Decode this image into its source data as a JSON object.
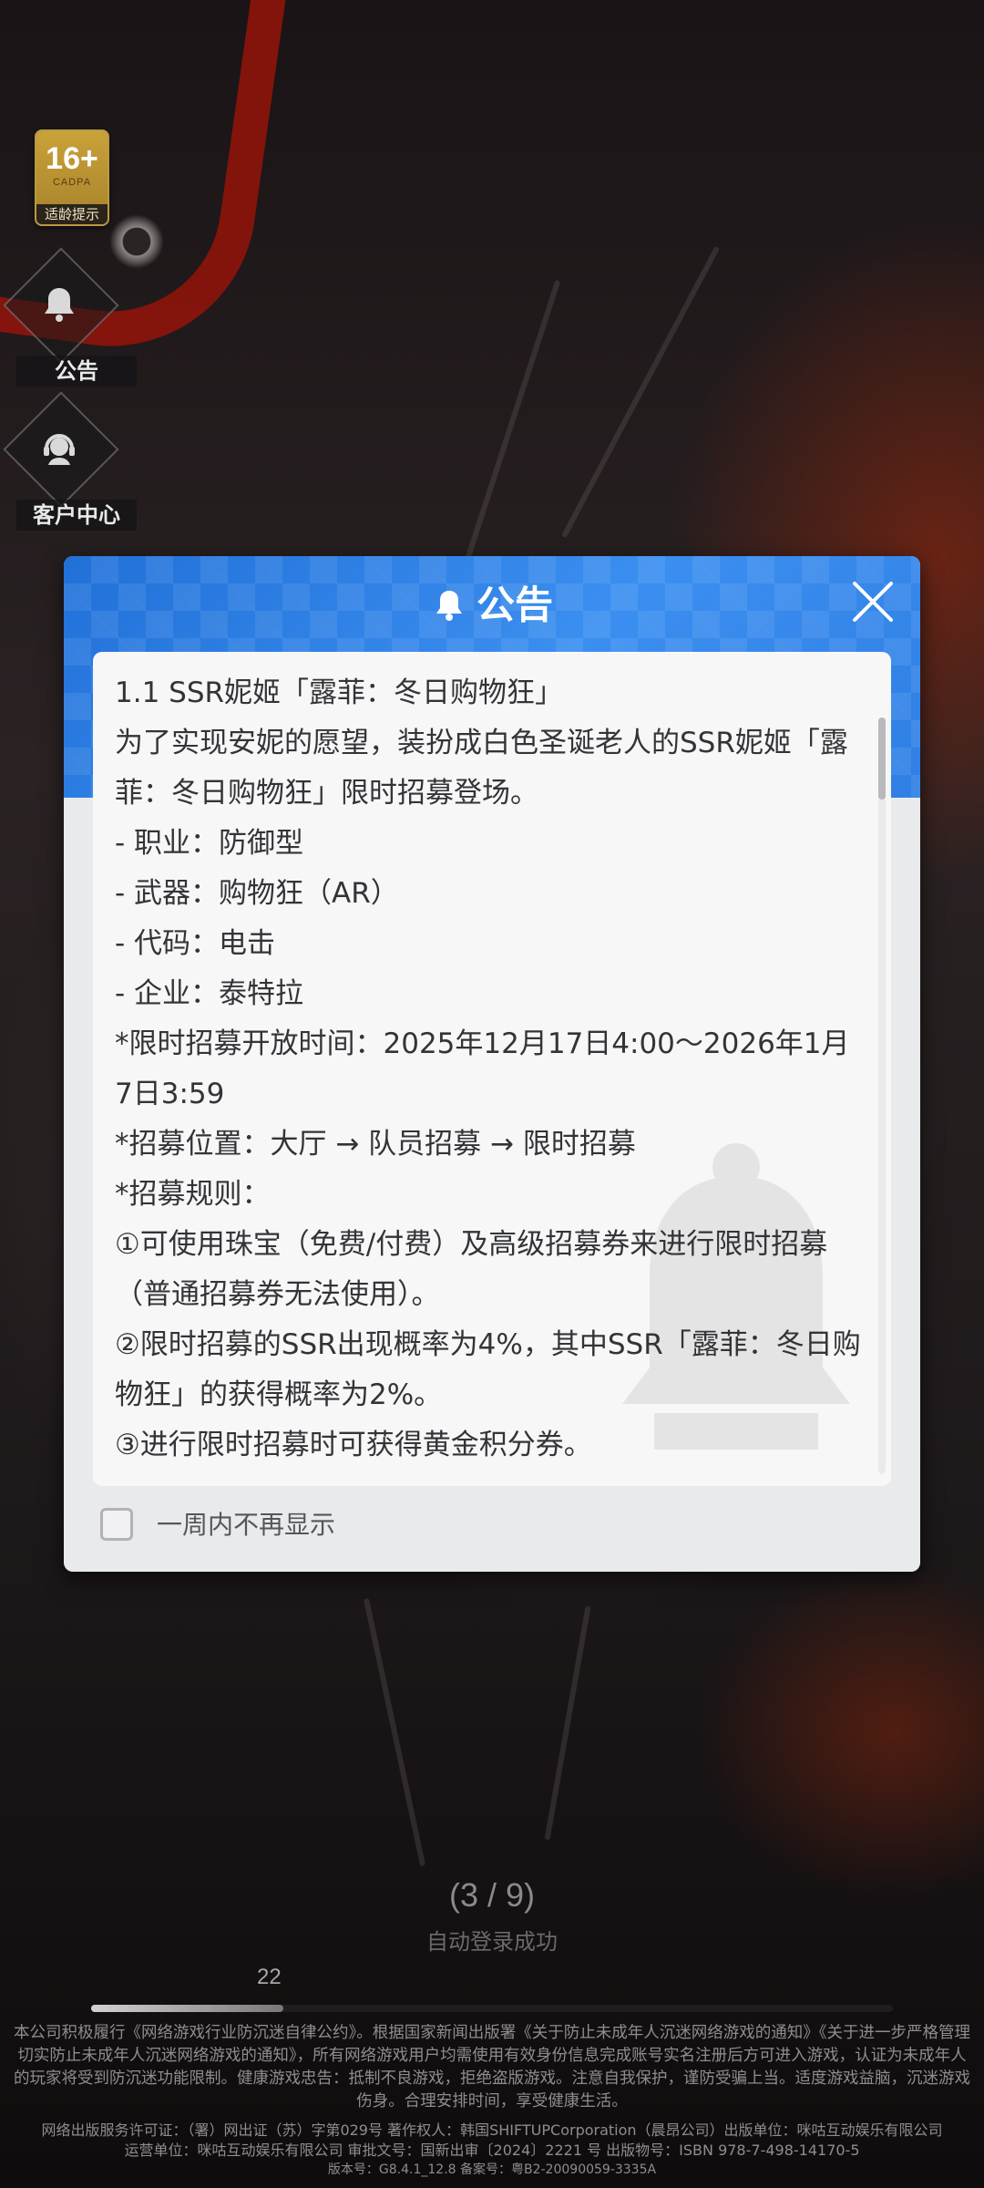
{
  "hud": {
    "age_rating": "16+",
    "age_org": "CADPA",
    "age_tip": "适龄提示",
    "notice_label": "公告",
    "support_label": "客户中心"
  },
  "dialog": {
    "title": "公告",
    "content": [
      "1.1 SSR妮姬「露菲：冬日购物狂」",
      "为了实现安妮的愿望，装扮成白色圣诞老人的SSR妮姬「露菲：冬日购物狂」限时招募登场。",
      " - 职业：防御型",
      " - 武器：购物狂（AR）",
      " - 代码：电击",
      " - 企业：泰特拉",
      "*限时招募开放时间：2025年12月17日4:00～2026年1月7日3:59",
      "*招募位置：大厅 → 队员招募 → 限时招募",
      "*招募规则：",
      "①可使用珠宝（免费/付费）及高级招募券来进行限时招募（普通招募券无法使用）。",
      "②限时招募的SSR出现概率为4%，其中SSR「露菲：冬日购物狂」的获得概率为2%。",
      "③进行限时招募时可获得黄金积分券。"
    ],
    "checkbox_label": "一周内不再显示",
    "checkbox_checked": false
  },
  "loading": {
    "counter": "(3 / 9)",
    "status": "自动登录成功",
    "number": "22",
    "progress_fraction": 0.24
  },
  "footer": {
    "notice": "本公司积极履行《网络游戏行业防沉迷自律公约》。根据国家新闻出版署《关于防止未成年人沉迷网络游戏的通知》《关于进一步严格管理切实防止未成年人沉迷网络游戏的通知》，所有网络游戏用户均需使用有效身份信息完成账号实名注册后方可进入游戏，认证为未成年人的玩家将受到防沉迷功能限制。健康游戏忠告：抵制不良游戏，拒绝盗版游戏。注意自我保护，谨防受骗上当。适度游戏益脑，沉迷游戏伤身。合理安排时间，享受健康生活。",
    "license": "网络出版服务许可证：（署）网出证（苏）字第029号 著作权人：韩国SHIFTUPCorporation（晨昂公司）出版单位：咪咕互动娱乐有限公司",
    "operator": "运营单位：咪咕互动娱乐有限公司 审批文号：国新出审〔2024〕2221 号 出版物号：ISBN 978-7-498-14170-5",
    "version": "版本号：G8.4.1_12.8    备案号：粤B2-20090059-3335A"
  },
  "colors": {
    "dialog_header": "#2f7fe4",
    "card_bg": "#f7f7f8",
    "age_badge": "#c9a23a"
  }
}
